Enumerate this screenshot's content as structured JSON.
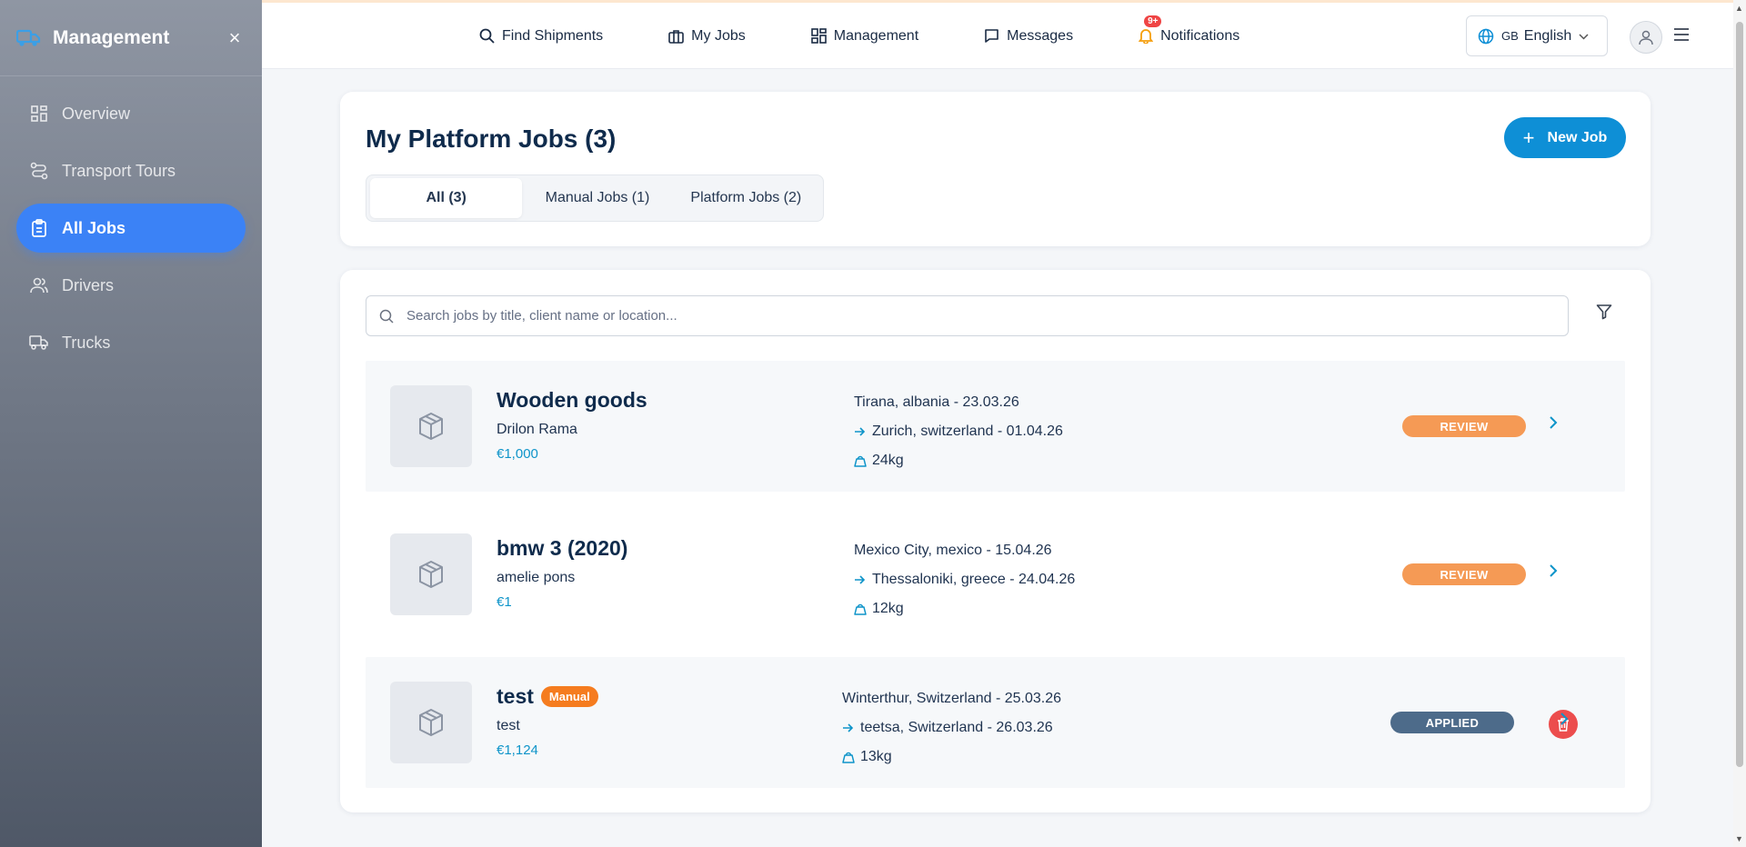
{
  "sidebar": {
    "title": "Management",
    "close_label": "×",
    "items": [
      {
        "label": "Overview",
        "icon": "grid-icon"
      },
      {
        "label": "Transport Tours",
        "icon": "route-icon"
      },
      {
        "label": "All Jobs",
        "icon": "clipboard-icon",
        "active": true
      },
      {
        "label": "Drivers",
        "icon": "users-icon"
      },
      {
        "label": "Trucks",
        "icon": "truck-icon"
      }
    ]
  },
  "topnav": {
    "find_shipments": "Find Shipments",
    "my_jobs": "My Jobs",
    "management": "Management",
    "messages": "Messages",
    "notifications": "Notifications",
    "notifications_badge": "9+"
  },
  "language": {
    "flag": "GB",
    "label": "English"
  },
  "header": {
    "title": "My Platform Jobs (3)",
    "new_job": "New Job",
    "tabs": [
      "All (3)",
      "Manual Jobs (1)",
      "Platform Jobs (2)"
    ]
  },
  "search": {
    "placeholder": "Search jobs by title, client name or location..."
  },
  "jobs": [
    {
      "title": "Wooden goods",
      "client": "Drilon Rama",
      "price": "€1,000",
      "from": "Tirana, albania - 23.03.26",
      "to": "Zurich, switzerland - 01.04.26",
      "weight": "24kg",
      "status": "REVIEW"
    },
    {
      "title": "bmw 3 (2020)",
      "client": "amelie pons",
      "price": "€1",
      "from": "Mexico City, mexico - 15.04.26",
      "to": "Thessaloniki, greece - 24.04.26",
      "weight": "12kg",
      "status": "REVIEW"
    },
    {
      "title": "test",
      "tag": "Manual",
      "client": "test",
      "price": "€1,124",
      "from": "Winterthur, Switzerland - 25.03.26",
      "to": "teetsa, Switzerland - 26.03.26",
      "weight": "13kg",
      "status": "APPLIED"
    }
  ],
  "colors": {
    "accent": "#3b82f6",
    "primary_button": "#0e8fd6",
    "review": "#f59a55",
    "applied": "#4d6b8a",
    "manual_tag": "#f57c1f",
    "delete": "#ec4d4d"
  }
}
